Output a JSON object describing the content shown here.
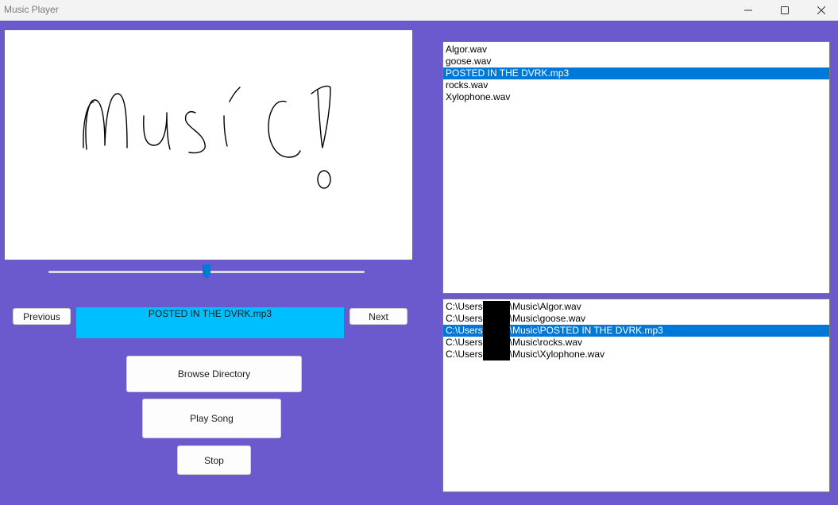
{
  "window": {
    "title": "Music Player",
    "controls": [
      "minimize-icon",
      "maximize-icon",
      "close-icon"
    ]
  },
  "colors": {
    "background": "#6a5acd",
    "now_playing_bg": "#00bfff",
    "selection": "#0078d7",
    "slider_thumb": "#0078d7"
  },
  "player": {
    "slider_position": 0.5,
    "previous_label": "Previous",
    "next_label": "Next",
    "now_playing": "POSTED IN THE DVRK.mp3",
    "browse_label": "Browse Directory",
    "play_label": "Play Song",
    "stop_label": "Stop"
  },
  "song_list": {
    "items": [
      {
        "label": "Algor.wav",
        "selected": false
      },
      {
        "label": "goose.wav",
        "selected": false
      },
      {
        "label": "POSTED IN THE DVRK.mp3",
        "selected": true
      },
      {
        "label": "rocks.wav",
        "selected": false
      },
      {
        "label": "Xylophone.wav",
        "selected": false
      }
    ]
  },
  "path_list": {
    "items": [
      {
        "prefix": "C:\\Users",
        "suffix": "\\Music\\Algor.wav",
        "selected": false
      },
      {
        "prefix": "C:\\Users",
        "suffix": "\\Music\\goose.wav",
        "selected": false
      },
      {
        "prefix": "C:\\Users",
        "suffix": "\\Music\\POSTED IN THE DVRK.mp3",
        "selected": true
      },
      {
        "prefix": "C:\\Users",
        "suffix": "\\Music\\rocks.wav",
        "selected": false
      },
      {
        "prefix": "C:\\Users",
        "suffix": "\\Music\\Xylophone.wav",
        "selected": false
      }
    ]
  }
}
